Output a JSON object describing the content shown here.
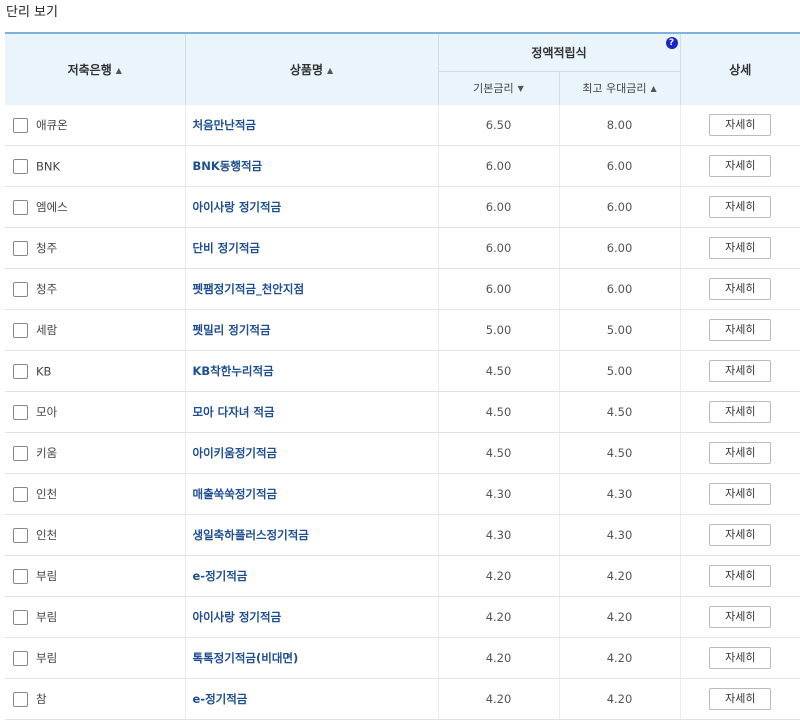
{
  "page": {
    "title": "단리 보기"
  },
  "table": {
    "headers": {
      "bank": "저축은행",
      "product": "상품명",
      "group": "정액적립식",
      "base_rate": "기본금리",
      "max_rate": "최고 우대금리",
      "detail": "상세"
    },
    "sort_icons": {
      "bank": "▲",
      "product": "▲",
      "base_rate": "▼",
      "max_rate": "▲"
    },
    "help_icon": "?",
    "detail_button_label": "자세히",
    "rows": [
      {
        "bank": "애큐온",
        "product": "처음만난적금",
        "base_rate": "6.50",
        "max_rate": "8.00"
      },
      {
        "bank": "BNK",
        "product": "BNK동행적금",
        "base_rate": "6.00",
        "max_rate": "6.00"
      },
      {
        "bank": "엠에스",
        "product": "아이사랑 정기적금",
        "base_rate": "6.00",
        "max_rate": "6.00"
      },
      {
        "bank": "청주",
        "product": "단비 정기적금",
        "base_rate": "6.00",
        "max_rate": "6.00"
      },
      {
        "bank": "청주",
        "product": "펫팸정기적금_천안지점",
        "base_rate": "6.00",
        "max_rate": "6.00"
      },
      {
        "bank": "세람",
        "product": "펫밀리 정기적금",
        "base_rate": "5.00",
        "max_rate": "5.00"
      },
      {
        "bank": "KB",
        "product": "KB착한누리적금",
        "base_rate": "4.50",
        "max_rate": "5.00"
      },
      {
        "bank": "모아",
        "product": "모아 다자녀 적금",
        "base_rate": "4.50",
        "max_rate": "4.50"
      },
      {
        "bank": "키움",
        "product": "아이키움정기적금",
        "base_rate": "4.50",
        "max_rate": "4.50"
      },
      {
        "bank": "인천",
        "product": "매출쑥쑥정기적금",
        "base_rate": "4.30",
        "max_rate": "4.30"
      },
      {
        "bank": "인천",
        "product": "생일축하플러스정기적금",
        "base_rate": "4.30",
        "max_rate": "4.30"
      },
      {
        "bank": "부림",
        "product": "e-정기적금",
        "base_rate": "4.20",
        "max_rate": "4.20"
      },
      {
        "bank": "부림",
        "product": "아이사랑 정기적금",
        "base_rate": "4.20",
        "max_rate": "4.20"
      },
      {
        "bank": "부림",
        "product": "톡톡정기적금(비대면)",
        "base_rate": "4.20",
        "max_rate": "4.20"
      },
      {
        "bank": "참",
        "product": "e-정기적금",
        "base_rate": "4.20",
        "max_rate": "4.20"
      }
    ]
  }
}
